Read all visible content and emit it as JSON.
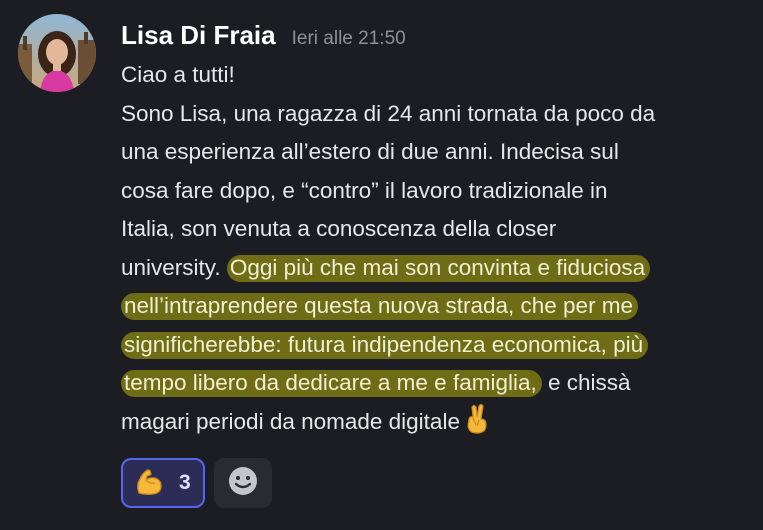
{
  "message": {
    "author": "Lisa Di Fraia",
    "timestamp": "Ieri alle 21:50",
    "lines": {
      "l1": "Ciao a tutti!",
      "l2": "Sono Lisa, una ragazza di 24 anni tornata da poco da",
      "l3": "una esperienza all’estero di due anni. Indecisa sul",
      "l4": "cosa fare dopo, e “contro” il lavoro tradizionale in",
      "l5": "Italia, son venuta a conoscenza della closer",
      "l6a": "university. ",
      "l6b": "Oggi più che mai son convinta e fiduciosa",
      "l7": "nell’intraprendere questa nuova strada, che per me",
      "l8": "significherebbe: futura indipendenza economica, più",
      "l9a": "tempo libero da dedicare a me e famiglia,",
      "l9b": " e chissà",
      "l10": "magari periodi da nomade digitale"
    },
    "highlight_color": "#6f6c16",
    "trailing_emoji": "crossed-fingers-icon"
  },
  "reactions": [
    {
      "emoji": "flexed-biceps-icon",
      "count": "3",
      "active": true,
      "accent": "#5865f2"
    }
  ],
  "add_reaction": {
    "icon": "add-reaction-smiley-icon"
  }
}
